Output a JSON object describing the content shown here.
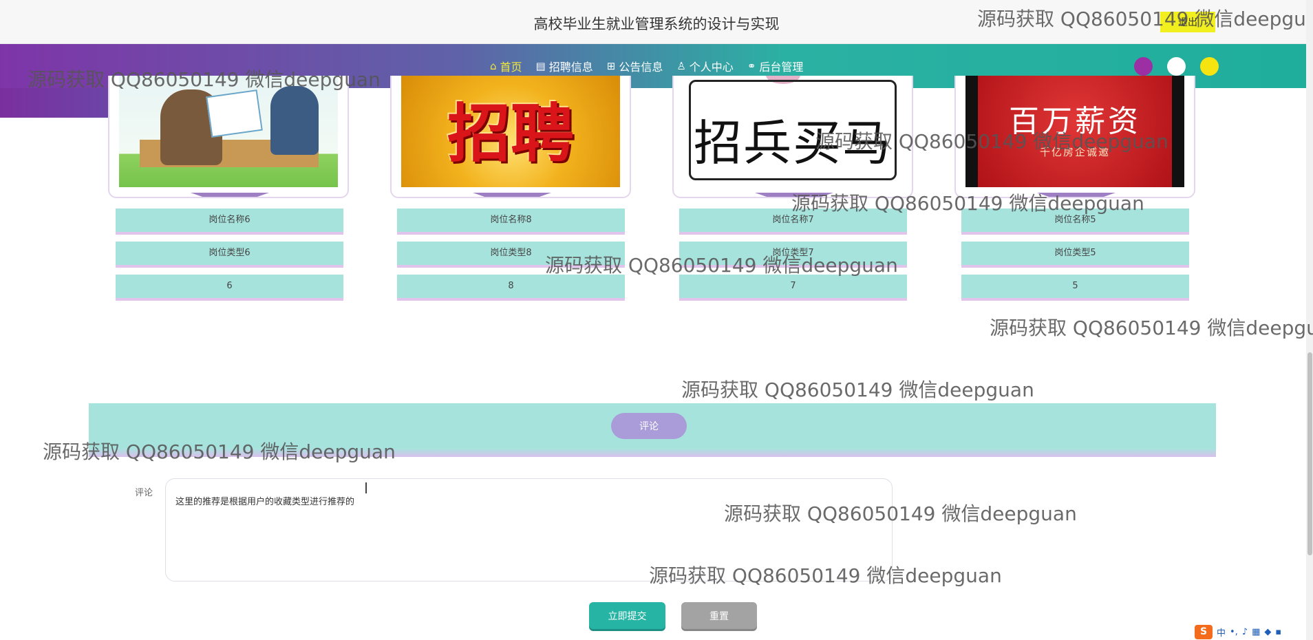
{
  "header": {
    "title": "高校毕业生就业管理系统的设计与实现",
    "logout_label": "退出"
  },
  "nav": {
    "items": [
      {
        "label": "首页",
        "icon": "home-icon",
        "glyph": "⌂"
      },
      {
        "label": "招聘信息",
        "icon": "calendar-icon",
        "glyph": "▤"
      },
      {
        "label": "公告信息",
        "icon": "gift-icon",
        "glyph": "⊞"
      },
      {
        "label": "个人中心",
        "icon": "user-icon",
        "glyph": "♙"
      },
      {
        "label": "后台管理",
        "icon": "link-icon",
        "glyph": "⚭"
      }
    ],
    "active_index": 0,
    "theme_colors": [
      "#9b2fa3",
      "#ffffff",
      "#f5e40f"
    ]
  },
  "jobs": [
    {
      "image_theme": "job-interview",
      "name": "岗位名称6",
      "type": "岗位类型6",
      "value": "6"
    },
    {
      "image_theme": "招聘",
      "name": "岗位名称8",
      "type": "岗位类型8",
      "value": "8"
    },
    {
      "image_theme": "招兵买马",
      "name": "岗位名称7",
      "type": "岗位类型7",
      "value": "7"
    },
    {
      "image_theme": "百万薪资",
      "name": "岗位名称5",
      "type": "岗位类型5",
      "value": "5",
      "image_sub": "千亿房企诚邀"
    }
  ],
  "comment": {
    "tab_label": "评论",
    "field_label": "评论",
    "value": "这里的推荐是根据用户的收藏类型进行推荐的",
    "submit_label": "立即提交",
    "reset_label": "重置"
  },
  "watermark": {
    "text": "源码获取 QQ86050149 微信deepguan",
    "text_clipped": "源码获取 QQ86050149 微信deepgu"
  },
  "tray": {
    "ime_logo": "S",
    "ime_lang": "中"
  }
}
